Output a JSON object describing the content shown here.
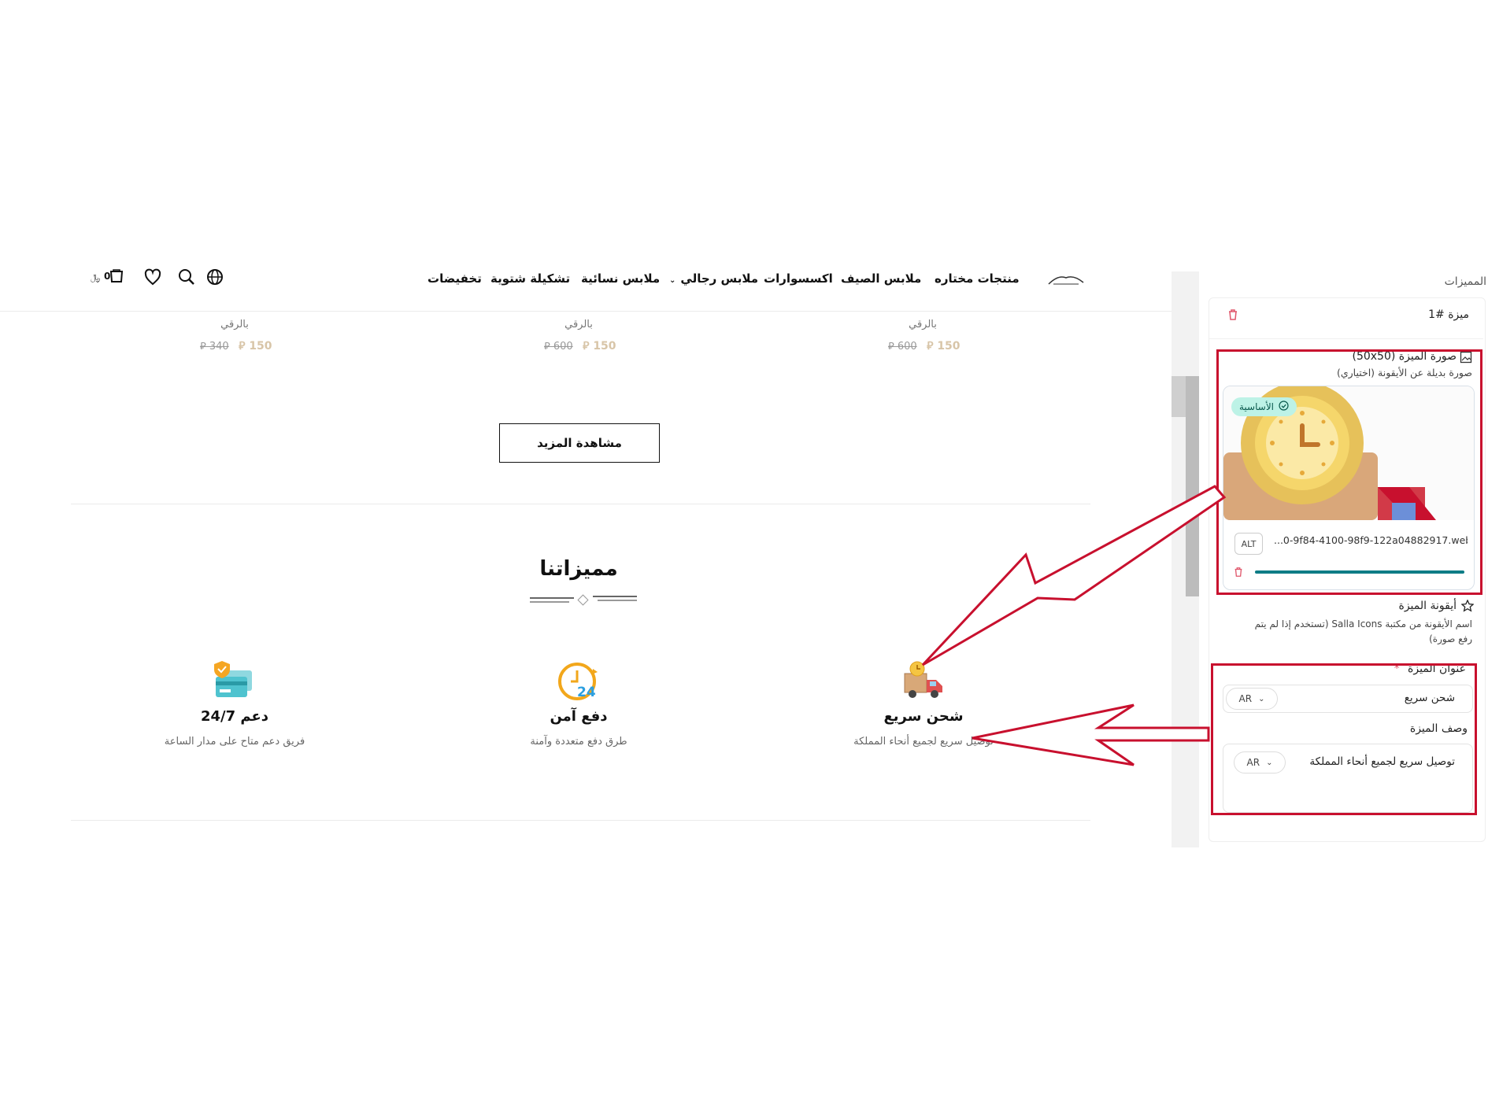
{
  "store": {
    "cart_count": "0",
    "nav": [
      "منتجات مختاره",
      "ملابس الصيف",
      "اكسسوارات",
      "ملابس رجالي",
      "ملابس نسائية",
      "تشكيلة شتوية",
      "تخفيضات"
    ],
    "products": [
      {
        "subtitle": "بالرقي",
        "price": "150",
        "old_price": "600"
      },
      {
        "subtitle": "بالرقي",
        "price": "150",
        "old_price": "600"
      },
      {
        "subtitle": "بالرقي",
        "price": "150",
        "old_price": "340"
      }
    ],
    "view_more_label": "مشاهدة المزيد",
    "features_heading": "مميزاتنا",
    "features": [
      {
        "icon": "delivery-truck-icon",
        "title": "شحن سريع",
        "desc": "توصيل سريع لجميع أنحاء المملكة"
      },
      {
        "icon": "clock-24-icon",
        "title": "دفع آمن",
        "desc": "طرق دفع متعددة وآمنة"
      },
      {
        "icon": "credit-card-shield-icon",
        "title": "دعم 24/7",
        "desc": "فريق دعم متاح على مدار الساعة"
      }
    ]
  },
  "panel": {
    "section_title": "المميزات",
    "item_label": "ميزة #1",
    "image_label": "صورة الميزة (50x50)",
    "image_hint": "صورة بديلة عن الأيقونة (اختياري)",
    "primary_badge": "الأساسية",
    "alt_label": "ALT",
    "filename": "...0-9f84-4100-98f9-122a04882917.webp",
    "icon_label": "أيقونة الميزة",
    "icon_hint_line1": "اسم الأيقونة من مكتبة Salla Icons (تستخدم إذا لم يتم",
    "icon_hint_line2": "رفع صورة)",
    "title_label": "عنوان الميزة",
    "required_mark": "*",
    "title_value": "شحن سريع",
    "lang": "AR",
    "desc_label": "وصف الميزة",
    "desc_value": "توصيل سريع لجميع أنحاء المملكة",
    "upload_progress": 1.0
  },
  "colors": {
    "annotation": "#c8102e",
    "accent": "#0e7c86",
    "badge_bg": "#bdf2e6",
    "delete": "#e0566b",
    "price_new": "#d8c5a8"
  }
}
